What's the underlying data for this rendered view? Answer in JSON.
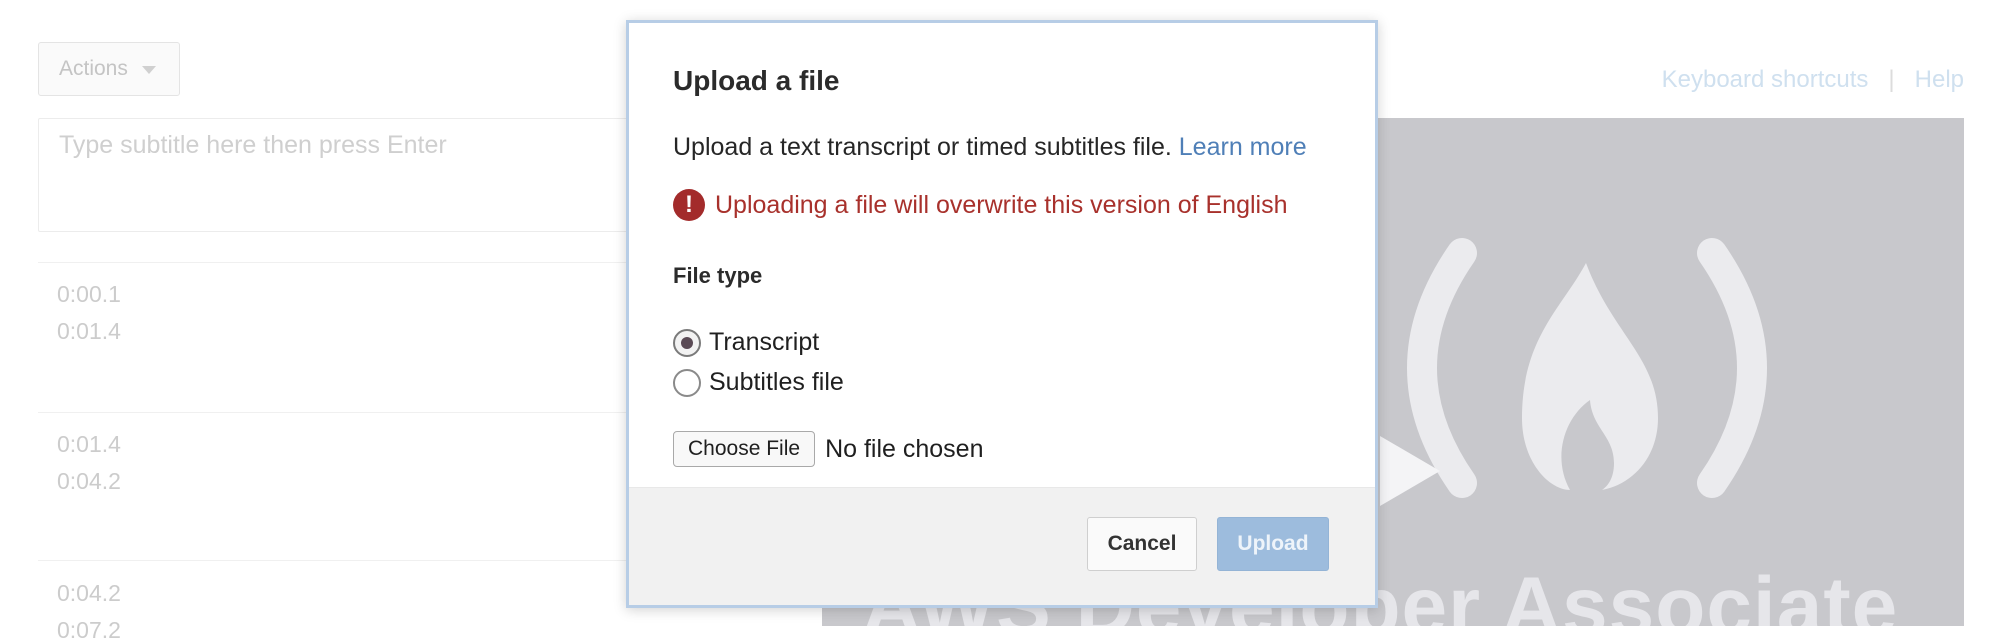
{
  "editor": {
    "actions_label": "Actions",
    "subtitle_placeholder": "Type subtitle here then press Enter",
    "cues": [
      {
        "start": "0:00.1",
        "end": "0:01.4"
      },
      {
        "start": "0:01.4",
        "end": "0:04.2"
      },
      {
        "start": "0:04.2",
        "end": "0:07.2"
      }
    ],
    "links": {
      "keyboard_shortcuts": "Keyboard shortcuts",
      "separator": "|",
      "help": "Help"
    }
  },
  "video": {
    "caption": "AWS Developer Associate"
  },
  "modal": {
    "title": "Upload a file",
    "description": "Upload a text transcript or timed subtitles file.",
    "learn_more": "Learn more",
    "warning_icon": "!",
    "warning": "Uploading a file will overwrite this version of English",
    "file_type_label": "File type",
    "options": [
      {
        "label": "Transcript",
        "checked": true
      },
      {
        "label": "Subtitles file",
        "checked": false
      }
    ],
    "choose_file_label": "Choose File",
    "file_status": "No file chosen",
    "cancel_label": "Cancel",
    "upload_label": "Upload"
  },
  "colors": {
    "warning": "#a8312c",
    "link": "#4f7fb7",
    "upload_disabled": "#9dbcdd",
    "modal_border": "#b7cde6"
  }
}
